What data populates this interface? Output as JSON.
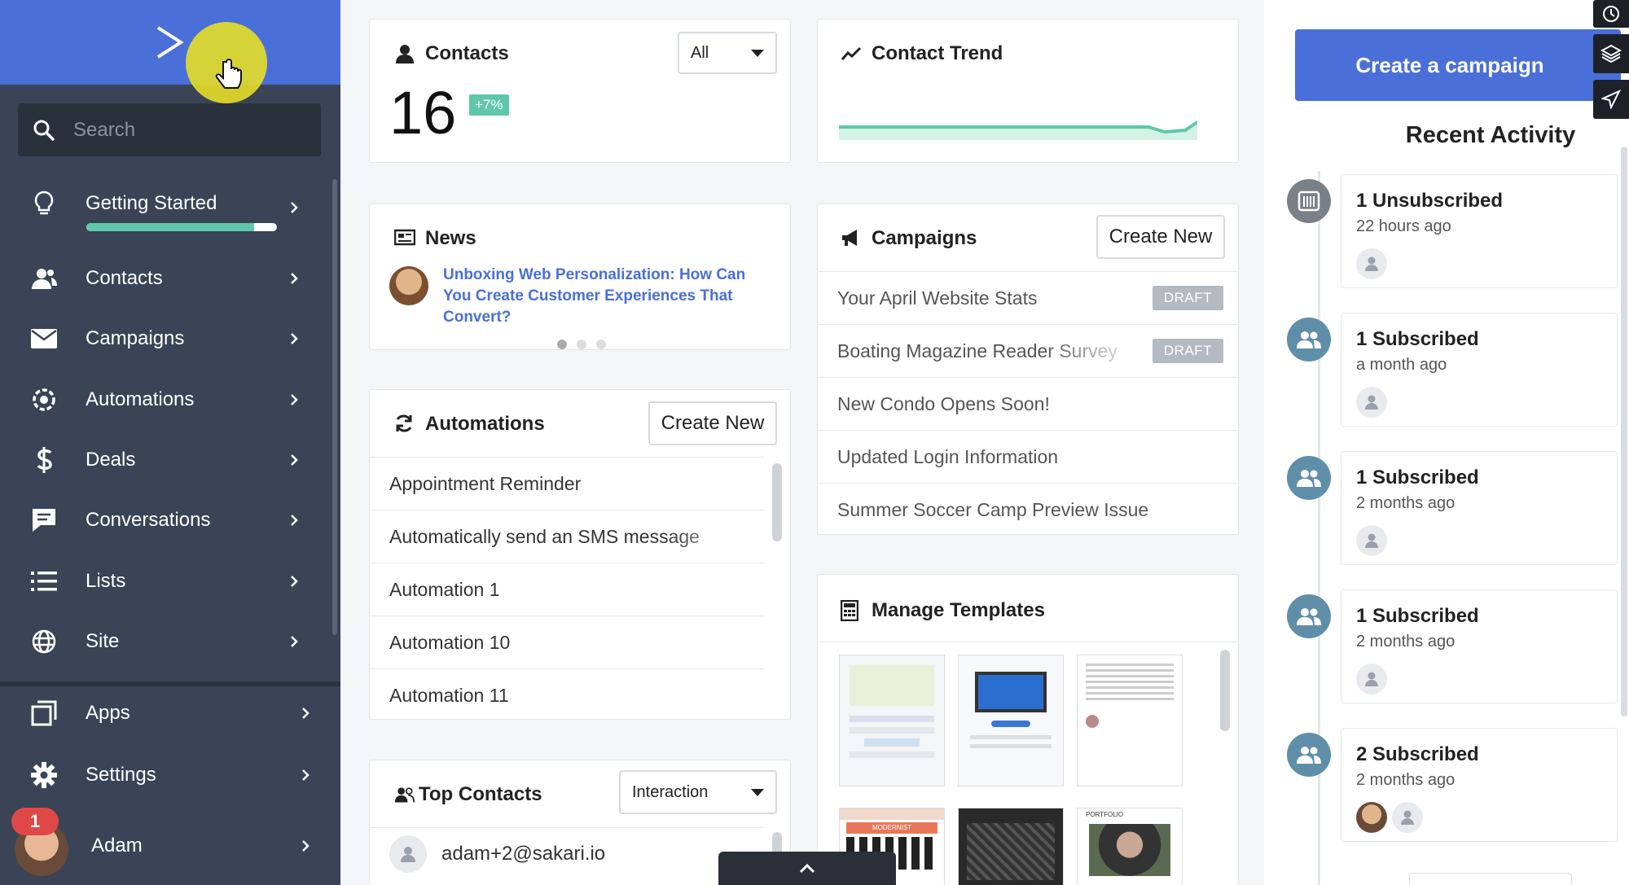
{
  "sidebar": {
    "search_placeholder": "Search",
    "items": [
      {
        "label": "Getting Started",
        "icon": "lightbulb-icon",
        "progress": 0.88
      },
      {
        "label": "Contacts",
        "icon": "contacts-icon"
      },
      {
        "label": "Campaigns",
        "icon": "envelope-icon"
      },
      {
        "label": "Automations",
        "icon": "automations-icon"
      },
      {
        "label": "Deals",
        "icon": "dollar-icon"
      },
      {
        "label": "Conversations",
        "icon": "chat-icon"
      },
      {
        "label": "Lists",
        "icon": "list-icon"
      },
      {
        "label": "Site",
        "icon": "globe-icon"
      }
    ],
    "bottom_items": [
      {
        "label": "Apps",
        "icon": "apps-icon"
      },
      {
        "label": "Settings",
        "icon": "gear-icon"
      }
    ],
    "user": {
      "name": "Adam",
      "notifications": "1"
    }
  },
  "contacts_card": {
    "title": "Contacts",
    "filter_value": "All",
    "count": "16",
    "change": "+7%"
  },
  "trend_card": {
    "title": "Contact Trend"
  },
  "news_card": {
    "title": "News",
    "headline": "Unboxing Web Personalization: How Can You Create Customer Experiences That Convert?"
  },
  "automations_card": {
    "title": "Automations",
    "create_label": "Create New",
    "items": [
      "Appointment Reminder",
      "Automatically send an SMS message",
      "Automation 1",
      "Automation 10",
      "Automation 11"
    ]
  },
  "top_contacts_card": {
    "title": "Top Contacts",
    "sort_value": "Interaction",
    "items": [
      "adam+2@sakari.io"
    ]
  },
  "campaigns_card": {
    "title": "Campaigns",
    "create_label": "Create New",
    "items": [
      {
        "name": "Your April Website Stats",
        "status": "DRAFT"
      },
      {
        "name": "Boating Magazine Reader Survey",
        "status": "DRAFT"
      },
      {
        "name": "New Condo Opens Soon!",
        "status": ""
      },
      {
        "name": "Updated Login Information",
        "status": ""
      },
      {
        "name": "Summer Soccer Camp Preview Issue",
        "status": ""
      }
    ]
  },
  "templates_card": {
    "title": "Manage Templates",
    "labels": [
      "MODERNIST",
      "PORTFOLIO"
    ]
  },
  "right_panel": {
    "create_campaign_label": "Create a campaign",
    "recent_activity_title": "Recent Activity",
    "activities": [
      {
        "title": "1 Unsubscribed",
        "time": "22 hours ago",
        "icon": "unsubscribe-icon"
      },
      {
        "title": "1 Subscribed",
        "time": "a month ago",
        "icon": "users-icon"
      },
      {
        "title": "1 Subscribed",
        "time": "2 months ago",
        "icon": "users-icon"
      },
      {
        "title": "1 Subscribed",
        "time": "2 months ago",
        "icon": "users-icon"
      },
      {
        "title": "2 Subscribed",
        "time": "2 months ago",
        "icon": "users-icon"
      }
    ]
  },
  "colors": {
    "brand": "#4a6fd8",
    "sidebar": "#3a4456",
    "trend": "#5fc8a8",
    "badge": "#5fc8a8"
  }
}
